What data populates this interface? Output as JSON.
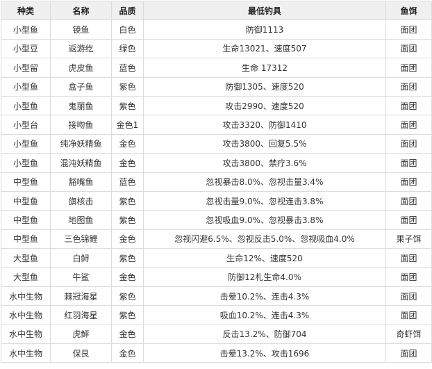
{
  "headers": {
    "type": "种类",
    "name": "名称",
    "quality": "品质",
    "min_attr": "最低钓具",
    "bait": "鱼饵"
  },
  "rows": [
    {
      "type": "小型鱼",
      "name": "镜鱼",
      "quality": "白色",
      "min_attr": "防御1113",
      "bait": "面团"
    },
    {
      "type": "小型豆",
      "name": "返游纥",
      "quality": "绿色",
      "min_attr": "生命13021、速度507",
      "bait": "面团"
    },
    {
      "type": "小型留",
      "name": "虎皮鱼",
      "quality": "蓝色",
      "min_attr": "生命 17312",
      "bait": "面团"
    },
    {
      "type": "小型鱼",
      "name": "盒子鱼",
      "quality": "紫色",
      "min_attr": "防御1305、速度520",
      "bait": "面团"
    },
    {
      "type": "小型鱼",
      "name": "鬼丽鱼",
      "quality": "紫色",
      "min_attr": "攻击2990、速度520",
      "bait": "面团"
    },
    {
      "type": "小型台",
      "name": "接吻鱼",
      "quality": "金色1",
      "min_attr": "攻击3320、防御1410",
      "bait": "面团"
    },
    {
      "type": "小型鱼",
      "name": "纯净妖精鱼",
      "quality": "金色",
      "min_attr": "攻击3800、回复5.5%",
      "bait": "面团"
    },
    {
      "type": "小型鱼",
      "name": "混沌妖精鱼",
      "quality": "金色",
      "min_attr": "攻击3800、禁疗3.6%",
      "bait": "面团"
    },
    {
      "type": "中型鱼",
      "name": "豁嘴鱼",
      "quality": "蓝色",
      "min_attr": "忽视暴击8.0%、忽视击量3.4%",
      "bait": "面团"
    },
    {
      "type": "中型鱼",
      "name": "旗核击",
      "quality": "紫色",
      "min_attr": "忽视击量9.0%、忽视连击3.8%",
      "bait": "面团"
    },
    {
      "type": "中型鱼",
      "name": "地图鱼",
      "quality": "紫色",
      "min_attr": "忽视吸血9.0%、忽视暴击3.8%",
      "bait": "面团"
    },
    {
      "type": "中型鱼",
      "name": "三色锦鲤",
      "quality": "金色",
      "min_attr": "忽视闪避6.5%、忽视反击5.0%、忽视吸血4.0%",
      "bait": "果子饵"
    },
    {
      "type": "大型鱼",
      "name": "白鲟",
      "quality": "紫色",
      "min_attr": "生命12%、速度520",
      "bait": "面团"
    },
    {
      "type": "大型鱼",
      "name": "牛鲨",
      "quality": "金色",
      "min_attr": "防御12札生命4.0%",
      "bait": "面团"
    },
    {
      "type": "水中生物",
      "name": "棘冠海星",
      "quality": "紫色",
      "min_attr": "击晕10.2%、连击4.3%",
      "bait": "面团"
    },
    {
      "type": "水中生物",
      "name": "红羽海星",
      "quality": "紫色",
      "min_attr": "吸血10.2%、连击4.3%",
      "bait": "面团"
    },
    {
      "type": "水中生物",
      "name": "虎鲆",
      "quality": "金色",
      "min_attr": "反击13.2%、防御704",
      "bait": "奇虾饵"
    },
    {
      "type": "水中生物",
      "name": "保艮",
      "quality": "金色",
      "min_attr": "击晕13.2%、攻击1696",
      "bait": "面团"
    }
  ]
}
